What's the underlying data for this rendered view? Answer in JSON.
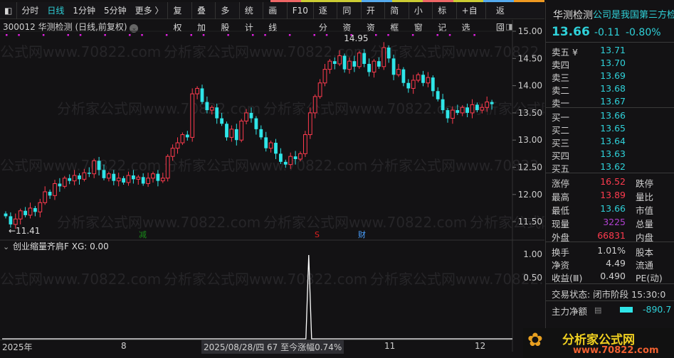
{
  "toolbar": {
    "left": [
      "分时",
      "日线",
      "1分钟",
      "5分钟",
      "更多 〉"
    ],
    "active": 1,
    "right": [
      "复权",
      "叠加",
      "多股",
      "统计",
      "画线",
      "F10",
      "逐分",
      "同资",
      "开资",
      "简框",
      "小窗",
      "标记",
      "+自选",
      "返回"
    ]
  },
  "info": {
    "title": "300012 华测检测 (日线,前复权)"
  },
  "watermark": "分析家公式网www.70822.com",
  "chart_data": {
    "type": "candlestick",
    "yticks": [
      "15.00",
      "14.50",
      "14.00",
      "13.50",
      "13.00",
      "12.50",
      "12.00",
      "11.50"
    ],
    "ylim": [
      11.35,
      15.12
    ],
    "close": [
      11.6,
      11.45,
      11.55,
      11.7,
      11.62,
      11.75,
      11.68,
      11.85,
      12.05,
      11.98,
      12.2,
      12.15,
      12.3,
      12.25,
      12.35,
      12.28,
      12.4,
      12.38,
      12.62,
      12.45,
      12.3,
      12.38,
      12.25,
      12.3,
      12.22,
      12.35,
      12.28,
      12.32,
      12.2,
      12.3,
      12.38,
      12.25,
      12.3,
      12.7,
      12.85,
      12.95,
      13.1,
      13.05,
      13.85,
      13.95,
      13.7,
      13.55,
      13.6,
      13.4,
      13.3,
      13.05,
      13.2,
      13.0,
      13.35,
      13.5,
      13.4,
      13.2,
      13.05,
      12.85,
      12.95,
      12.75,
      12.6,
      12.55,
      12.7,
      12.65,
      12.75,
      13.1,
      13.5,
      13.8,
      14.05,
      14.3,
      14.45,
      14.4,
      14.55,
      14.3,
      14.45,
      14.35,
      14.6,
      14.4,
      14.25,
      14.45,
      14.35,
      14.7,
      14.5,
      14.2,
      14.3,
      14.05,
      13.95,
      14.1,
      14.2,
      14.05,
      14.15,
      13.9,
      13.75,
      13.55,
      13.4,
      13.55,
      13.5,
      13.6,
      13.5,
      13.65,
      13.55,
      13.6,
      13.7,
      13.66
    ],
    "high_label": "14.95",
    "low_label": "←11.41",
    "markers": [
      {
        "text": "减",
        "color": "#1a8a1a"
      },
      {
        "text": "S",
        "color": "#e02020"
      },
      {
        "text": "财",
        "color": "#4aa0ff"
      }
    ],
    "indicator": {
      "name": "创业缩量齐肩F",
      "value_label": "XG: 0.00",
      "yticks": [
        "1.00",
        "0.50"
      ],
      "spike_index": 62
    },
    "xlabels": [
      "2025年",
      "8",
      "11",
      "12"
    ],
    "cursor_label": "2025/08/28/四 67 至今涨幅0.74%"
  },
  "quote": {
    "name": "华测检测",
    "ticker": "公司是我国第三方检",
    "price": "13.66",
    "change": "-0.11",
    "pct": "-0.80%",
    "sells": [
      {
        "l": "卖五 ¥",
        "v": "13.71"
      },
      {
        "l": "卖四",
        "v": "13.70"
      },
      {
        "l": "卖三",
        "v": "13.69"
      },
      {
        "l": "卖二",
        "v": "13.68"
      },
      {
        "l": "卖一",
        "v": "13.67"
      }
    ],
    "buys": [
      {
        "l": "买一",
        "v": "13.66"
      },
      {
        "l": "买二",
        "v": "13.65"
      },
      {
        "l": "买三",
        "v": "13.64"
      },
      {
        "l": "买四",
        "v": "13.63"
      },
      {
        "l": "买五",
        "v": "13.62"
      }
    ],
    "stats": [
      {
        "l": "涨停",
        "v": "16.52",
        "c": "#ff3b4e",
        "r": "跌停"
      },
      {
        "l": "最高",
        "v": "13.89",
        "c": "#ff3b4e",
        "r": "量比"
      },
      {
        "l": "最低",
        "v": "13.66",
        "c": "#2fd1d9",
        "r": "市值"
      },
      {
        "l": "现量",
        "v": "3225",
        "c": "#b040d0",
        "r": "总量"
      },
      {
        "l": "外盘",
        "v": "66831",
        "c": "#ff3b4e",
        "r": "内盘"
      }
    ],
    "stats2": [
      {
        "l": "换手",
        "v": "1.01%",
        "r": "股本"
      },
      {
        "l": "净资",
        "v": "4.49",
        "r": "流通"
      },
      {
        "l": "收益(Ⅲ)",
        "v": "0.490",
        "r": "PE(动)"
      }
    ],
    "status": "交易状态: 闭市阶段 15:30:0",
    "netflow_label": "主力净额",
    "netflow": "-890.7"
  },
  "logo": {
    "text": "分析家公式网",
    "url": "www.70822.com"
  }
}
